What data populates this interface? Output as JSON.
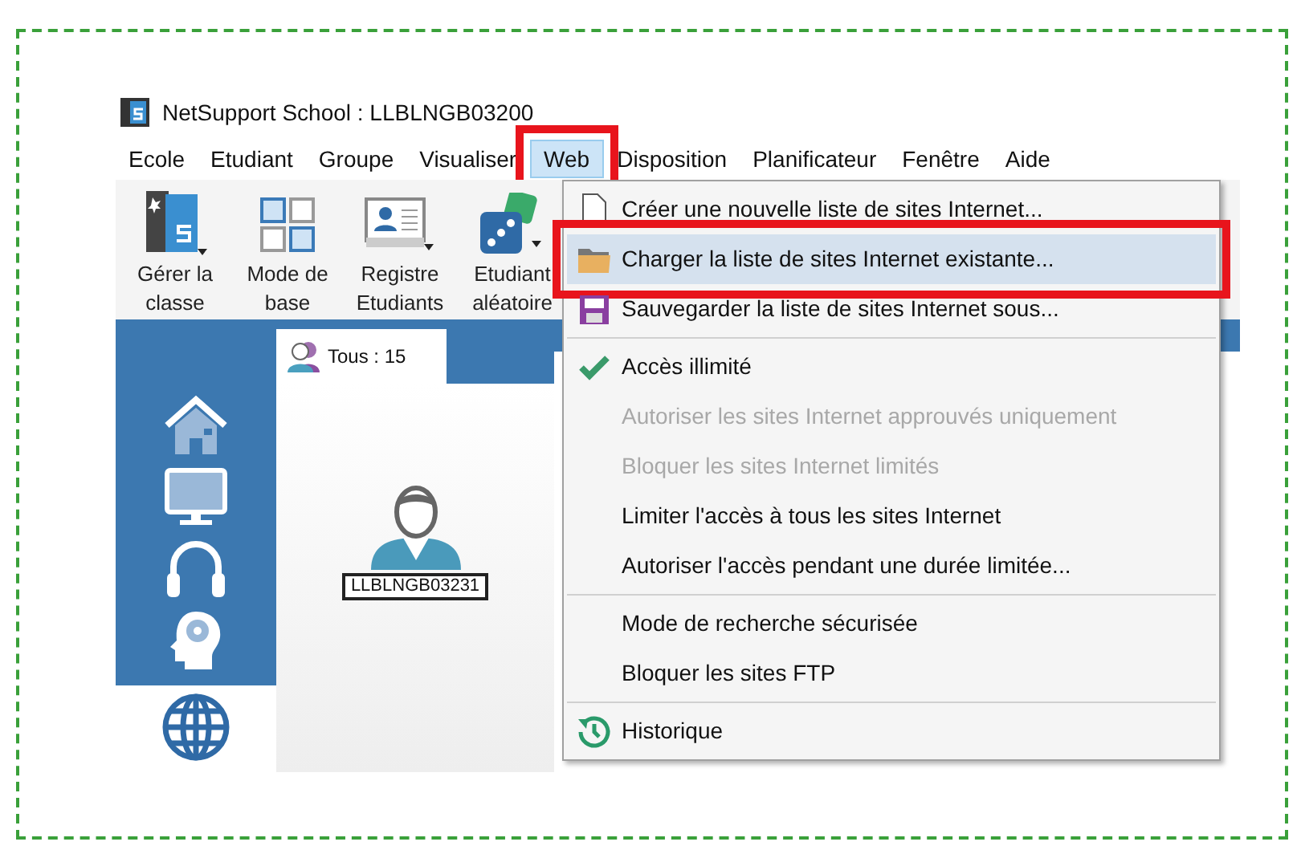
{
  "window": {
    "title": "NetSupport School : LLBLNGB03200"
  },
  "menu_bar": [
    {
      "label": "Ecole",
      "selected": false,
      "highlighted": false
    },
    {
      "label": "Etudiant",
      "selected": false,
      "highlighted": false
    },
    {
      "label": "Groupe",
      "selected": false,
      "highlighted": false
    },
    {
      "label": "Visualiser",
      "selected": false,
      "highlighted": false
    },
    {
      "label": "Web",
      "selected": true,
      "highlighted": true
    },
    {
      "label": "Disposition",
      "selected": false,
      "highlighted": false
    },
    {
      "label": "Planificateur",
      "selected": false,
      "highlighted": false
    },
    {
      "label": "Fenêtre",
      "selected": false,
      "highlighted": false
    },
    {
      "label": "Aide",
      "selected": false,
      "highlighted": false
    }
  ],
  "toolbar": [
    {
      "kind": "class",
      "lines": [
        "Gérer la",
        "classe"
      ]
    },
    {
      "kind": "grid",
      "lines": [
        "Mode de",
        "base"
      ]
    },
    {
      "kind": "register",
      "lines": [
        "Registre",
        "Etudiants"
      ]
    },
    {
      "kind": "dice",
      "lines": [
        "Etudiant",
        "aléatoire"
      ]
    }
  ],
  "sidebar": [
    {
      "kind": "home"
    },
    {
      "kind": "monitor"
    },
    {
      "kind": "headphones"
    },
    {
      "kind": "brain"
    },
    {
      "kind": "globe",
      "selected": true
    }
  ],
  "tab": {
    "label": "Tous : 15",
    "selected": true
  },
  "students": [
    {
      "name": "LLBLNGB03231"
    }
  ],
  "web_menu": [
    {
      "kind": "new",
      "label": "Créer une nouvelle liste de sites Internet...",
      "disabled": false,
      "checked": false,
      "selected": false,
      "highlighted": false
    },
    {
      "kind": "load",
      "label": "Charger la liste de sites Internet existante...",
      "disabled": false,
      "checked": false,
      "selected": true,
      "highlighted": true
    },
    {
      "kind": "save",
      "label": "Sauvegarder la liste de sites Internet sous...",
      "disabled": false,
      "checked": false,
      "selected": false,
      "highlighted": false
    },
    {
      "kind": "separator"
    },
    {
      "kind": "option",
      "label": "Accès illimité",
      "disabled": false,
      "checked": true,
      "selected": false,
      "highlighted": false
    },
    {
      "kind": "option",
      "label": "Autoriser les sites Internet approuvés uniquement",
      "disabled": true,
      "checked": false,
      "selected": false,
      "highlighted": false
    },
    {
      "kind": "option",
      "label": "Bloquer les sites Internet limités",
      "disabled": true,
      "checked": false,
      "selected": false,
      "highlighted": false
    },
    {
      "kind": "option",
      "label": "Limiter l'accès à tous les sites Internet",
      "disabled": false,
      "checked": false,
      "selected": false,
      "highlighted": false
    },
    {
      "kind": "option",
      "label": "Autoriser l'accès pendant une durée limitée...",
      "disabled": false,
      "checked": false,
      "selected": false,
      "highlighted": false
    },
    {
      "kind": "separator"
    },
    {
      "kind": "option",
      "label": "Mode de recherche sécurisée",
      "disabled": false,
      "checked": false,
      "selected": false,
      "highlighted": false
    },
    {
      "kind": "option",
      "label": "Bloquer les sites FTP",
      "disabled": false,
      "checked": false,
      "selected": false,
      "highlighted": false
    },
    {
      "kind": "separator"
    },
    {
      "kind": "history",
      "label": "Historique",
      "disabled": false,
      "checked": false,
      "selected": false,
      "highlighted": false
    }
  ]
}
